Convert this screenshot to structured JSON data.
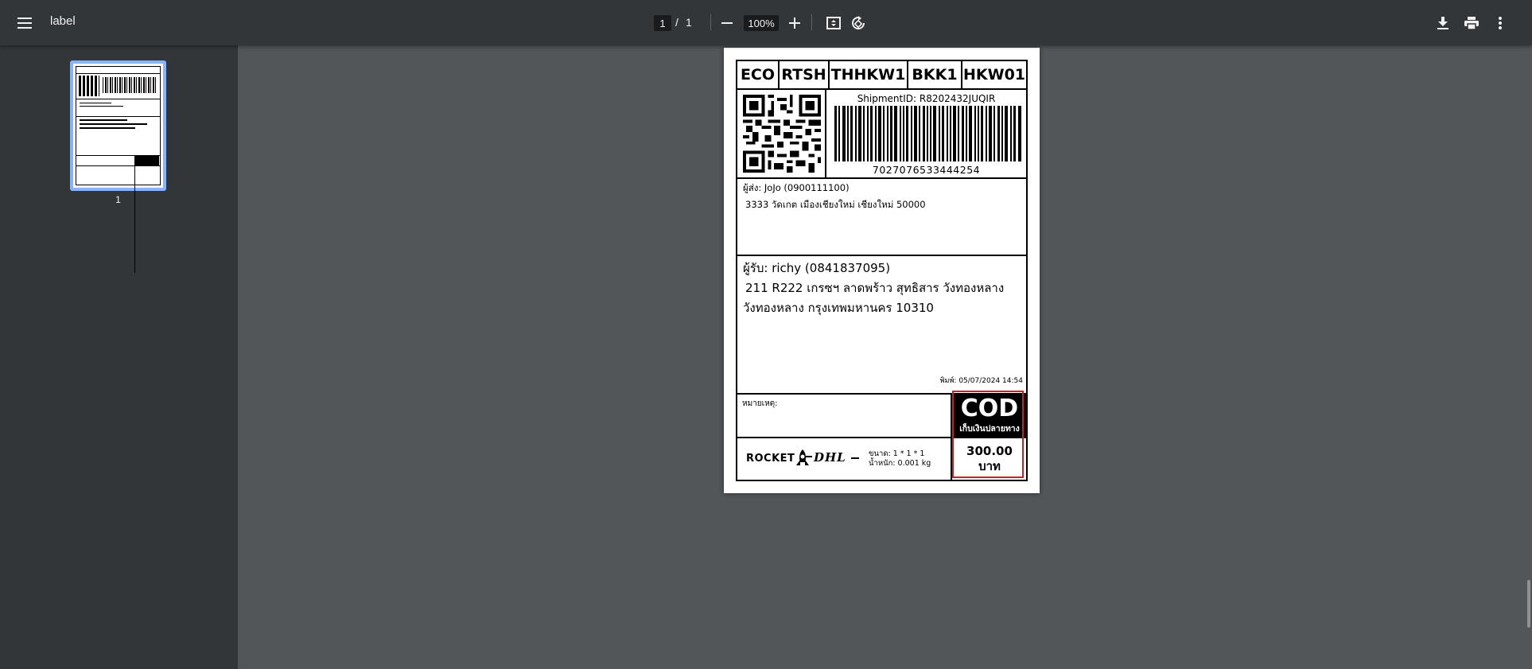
{
  "toolbar": {
    "menu_icon": "menu-icon",
    "title": "label",
    "page_current": "1",
    "page_separator": "/",
    "page_total": "1",
    "zoom": "100%",
    "icons": [
      "zoom-out-icon",
      "zoom-in-icon",
      "fit-page-icon",
      "rotate-icon",
      "download-icon",
      "print-icon",
      "more-vert-icon"
    ]
  },
  "sidebar": {
    "thumbnails": [
      {
        "page_number": "1",
        "selected": true
      }
    ]
  },
  "label": {
    "codes": [
      "ECO",
      "RTSH",
      "THHKW1",
      "BKK1",
      "HKW01"
    ],
    "shipment_id": "ShipmentID: R8202432JUQIR",
    "tracking_number": "7027076533444254",
    "sender_line1": "ผู้ส่ง: JoJo (0900111100)",
    "sender_line2": "3333 วัดเกต เมืองเชียงใหม่ เชียงใหม่ 50000",
    "receiver_line1": "ผู้รับ: richy  (0841837095)",
    "receiver_line2": "211 R222 เกรซฯ ลาดพร้าว สุทธิสาร วังทองหลาง",
    "receiver_line3": "วังทองหลาง กรุงเทพมหานคร 10310",
    "printed": "พิมพ์: 05/07/2024 14:54",
    "note_label": "หมายเหตุ:",
    "cod_title": "COD",
    "cod_subtitle": "เก็บเงินปลายทาง",
    "amount": "300.00",
    "currency": "บาท",
    "rocket_logo": "ROCKET",
    "dhl_logo": "DHL",
    "size_text": "ขนาด: 1 * 1 * 1",
    "weight_text": "น้ำหนัก: 0.001 kg"
  },
  "colors": {
    "toolbar_bg": "#323639",
    "viewer_bg": "#525659",
    "thumb_border": "#8ab4f8",
    "highlight": "#d21d1d"
  }
}
